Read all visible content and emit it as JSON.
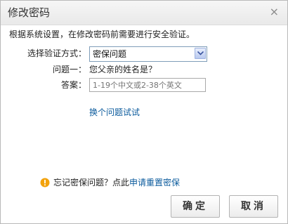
{
  "dialog": {
    "title": "修改密码",
    "close_symbol": "×",
    "notice": "根据系统设置，在修改密码前需要进行安全验证。"
  },
  "form": {
    "method_label": "选择验证方式：",
    "method_value": "密保问题",
    "question_label": "问题一：",
    "question_text": "您父亲的姓名是？",
    "answer_label": "答案：",
    "answer_placeholder": "1-19个中文或2-38个英文",
    "change_question_link": "换个问题试试"
  },
  "footer_note": {
    "text": "忘记密保问题？点此",
    "link": "申请重置密保",
    "icon": "warning-icon",
    "icon_color": "#f0a000"
  },
  "buttons": {
    "ok_label": "确定",
    "cancel_label": "取消"
  },
  "colors": {
    "link": "#0a5a9c"
  }
}
